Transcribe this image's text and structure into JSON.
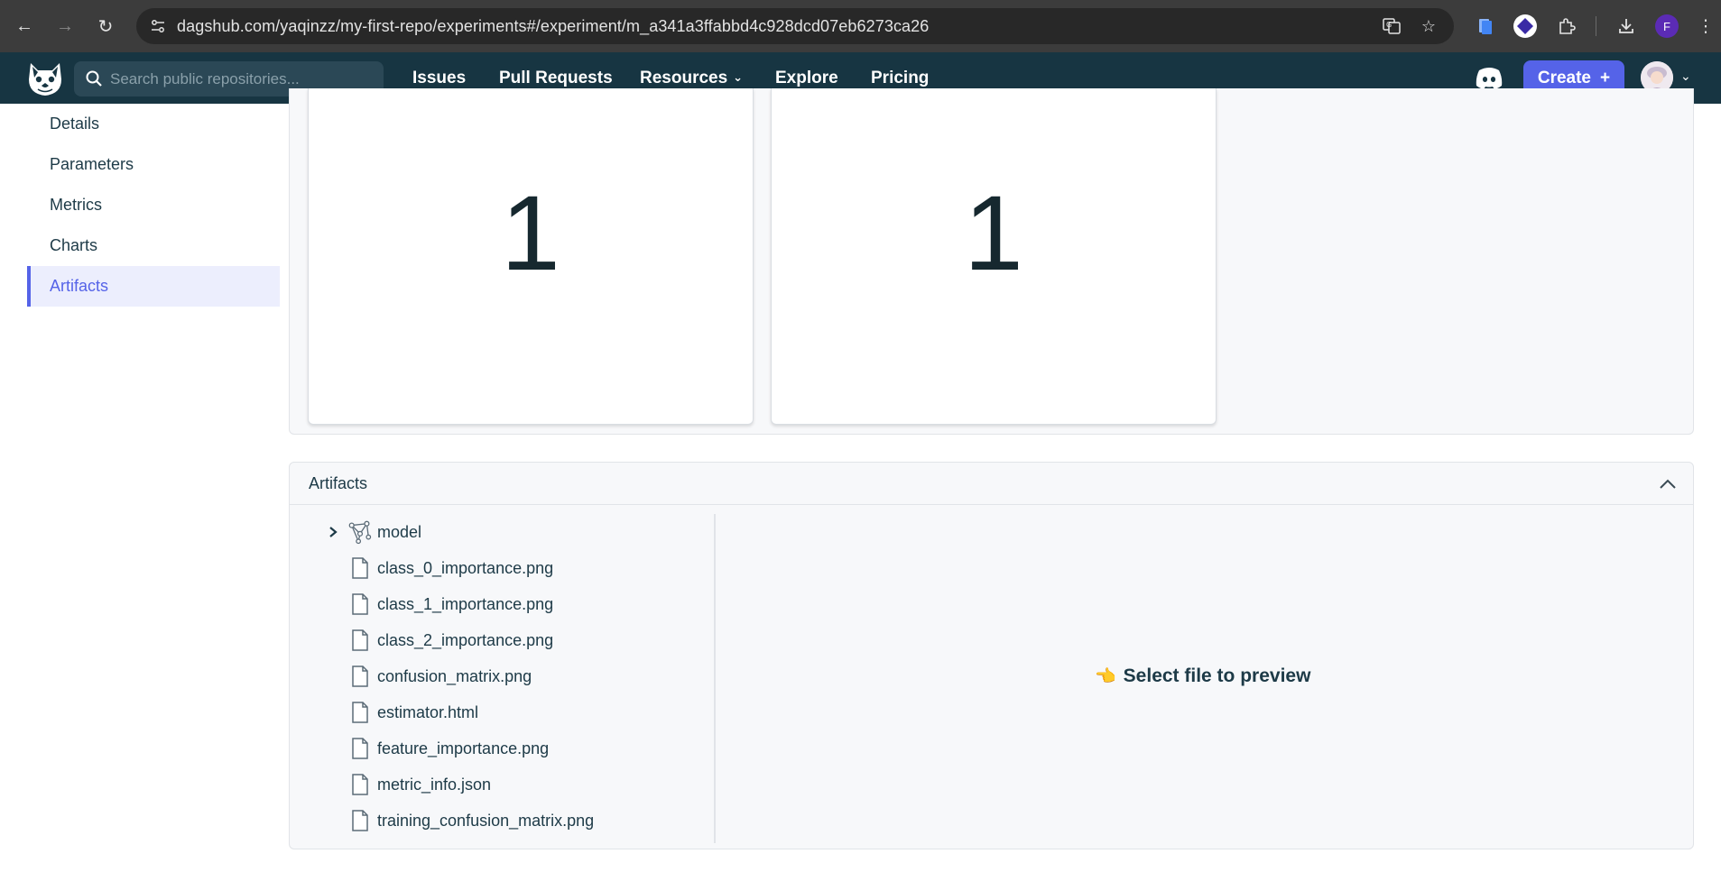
{
  "browser": {
    "url": "dagshub.com/yaqinzz/my-first-repo/experiments#/experiment/m_a341a3ffabbd4c928dcd07eb6273ca26",
    "profile_initial": "F"
  },
  "header": {
    "search_placeholder": "Search public repositories...",
    "nav": [
      {
        "label": "Issues"
      },
      {
        "label": "Pull Requests"
      },
      {
        "label": "Resources"
      },
      {
        "label": "Explore"
      },
      {
        "label": "Pricing"
      }
    ],
    "create_label": "Create",
    "create_icon": "+"
  },
  "sidebar": {
    "items": [
      {
        "label": "Details",
        "active": false
      },
      {
        "label": "Parameters",
        "active": false
      },
      {
        "label": "Metrics",
        "active": false
      },
      {
        "label": "Charts",
        "active": false
      },
      {
        "label": "Artifacts",
        "active": true
      }
    ]
  },
  "metrics": {
    "cards": [
      {
        "value": "1"
      },
      {
        "value": "1"
      }
    ]
  },
  "artifacts": {
    "title": "Artifacts",
    "tree": [
      {
        "name": "model",
        "type": "folder",
        "expanded": false
      },
      {
        "name": "class_0_importance.png",
        "type": "file"
      },
      {
        "name": "class_1_importance.png",
        "type": "file"
      },
      {
        "name": "class_2_importance.png",
        "type": "file"
      },
      {
        "name": "confusion_matrix.png",
        "type": "file"
      },
      {
        "name": "estimator.html",
        "type": "file"
      },
      {
        "name": "feature_importance.png",
        "type": "file"
      },
      {
        "name": "metric_info.json",
        "type": "file"
      },
      {
        "name": "training_confusion_matrix.png",
        "type": "file"
      }
    ],
    "preview_message": "Select file to preview",
    "preview_icon": "👈"
  },
  "colors": {
    "accent": "#5563e8",
    "nav_bg": "#173542",
    "sidebar_active_bg": "#eceefd"
  }
}
